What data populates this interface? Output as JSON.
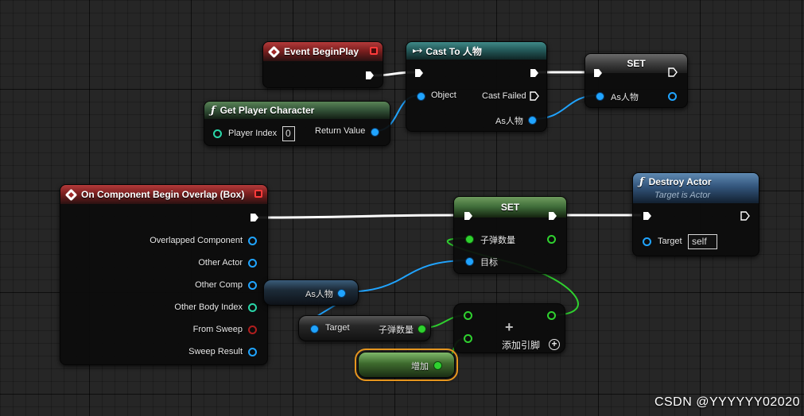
{
  "nodes": {
    "event_begin_play": {
      "title": "Event BeginPlay"
    },
    "cast_to": {
      "title": "Cast To 人物",
      "pins": {
        "object": "Object",
        "cast_failed": "Cast Failed",
        "as_out": "As人物"
      }
    },
    "set_top": {
      "title": "SET",
      "pins": {
        "as_in": "As人物"
      }
    },
    "get_player_character": {
      "title": "Get Player Character",
      "pins": {
        "player_index": "Player Index",
        "player_index_value": "0",
        "return_value": "Return Value"
      }
    },
    "on_component_begin_overlap": {
      "title": "On Component Begin Overlap (Box)",
      "pins": [
        "Overlapped Component",
        "Other Actor",
        "Other Comp",
        "Other Body Index",
        "From Sweep",
        "Sweep Result"
      ]
    },
    "set_bottom": {
      "title": "SET",
      "pins": {
        "bullet_count": "子弹数量",
        "target": "目标"
      }
    },
    "destroy_actor": {
      "title": "Destroy Actor",
      "subtitle": "Target is Actor",
      "pins": {
        "target": "Target",
        "target_value": "self"
      }
    },
    "as_var": {
      "label": "As人物"
    },
    "get_bullet": {
      "target": "Target",
      "out": "子弹数量"
    },
    "add_node": {
      "symbol": "+",
      "add_pin": "添加引脚"
    },
    "increment": {
      "label": "增加"
    }
  },
  "watermark": "CSDN @YYYYYY02020",
  "colors": {
    "exec": "#ffffff",
    "object_pin": "#20a4ff",
    "int_pin": "#2fd12f",
    "event_header": "#a12828",
    "selection": "#e6961e"
  }
}
